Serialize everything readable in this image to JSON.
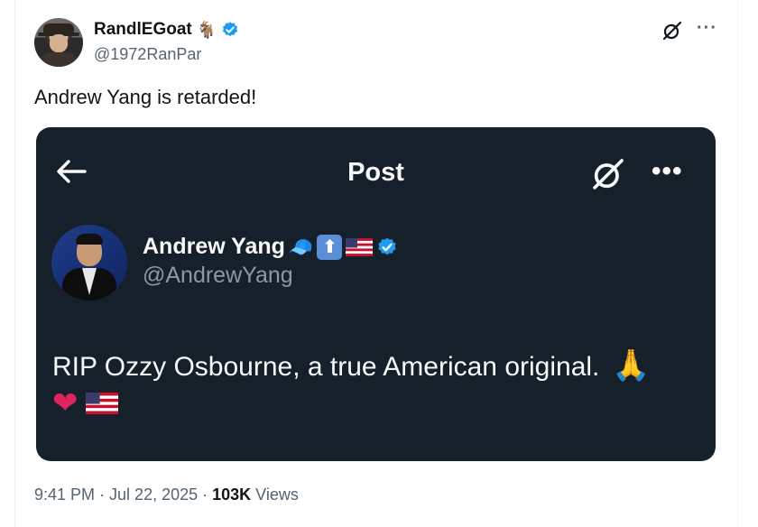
{
  "author": {
    "name": "RandlEGoat",
    "name_emoji": "🐐",
    "handle": "@1972RanPar",
    "verified": true
  },
  "tweet": {
    "text": "Andrew Yang is retarded!"
  },
  "header_actions": {
    "grok_icon": "grok-icon",
    "more_label": "···"
  },
  "embed": {
    "title": "Post",
    "back_icon": "back-arrow-icon",
    "more_label": "•••",
    "author": {
      "name": "Andrew Yang",
      "handle": "@AndrewYang",
      "verified": true,
      "emojis": [
        "🧢",
        "⬆",
        "🇺🇸"
      ]
    },
    "text": "RIP Ozzy Osbourne, a true American original.",
    "text_emoji": "🙏",
    "line2_emojis": [
      "❤",
      "🇺🇸"
    ]
  },
  "meta": {
    "time": "9:41 PM",
    "sep1": " · ",
    "date": "Jul 22, 2025",
    "sep2": " · ",
    "views_count": "103K",
    "views_label": " Views"
  },
  "colors": {
    "verified": "#1d9bf0",
    "embed_bg": "#15202b",
    "text": "#0f1419",
    "secondary": "#536471"
  }
}
